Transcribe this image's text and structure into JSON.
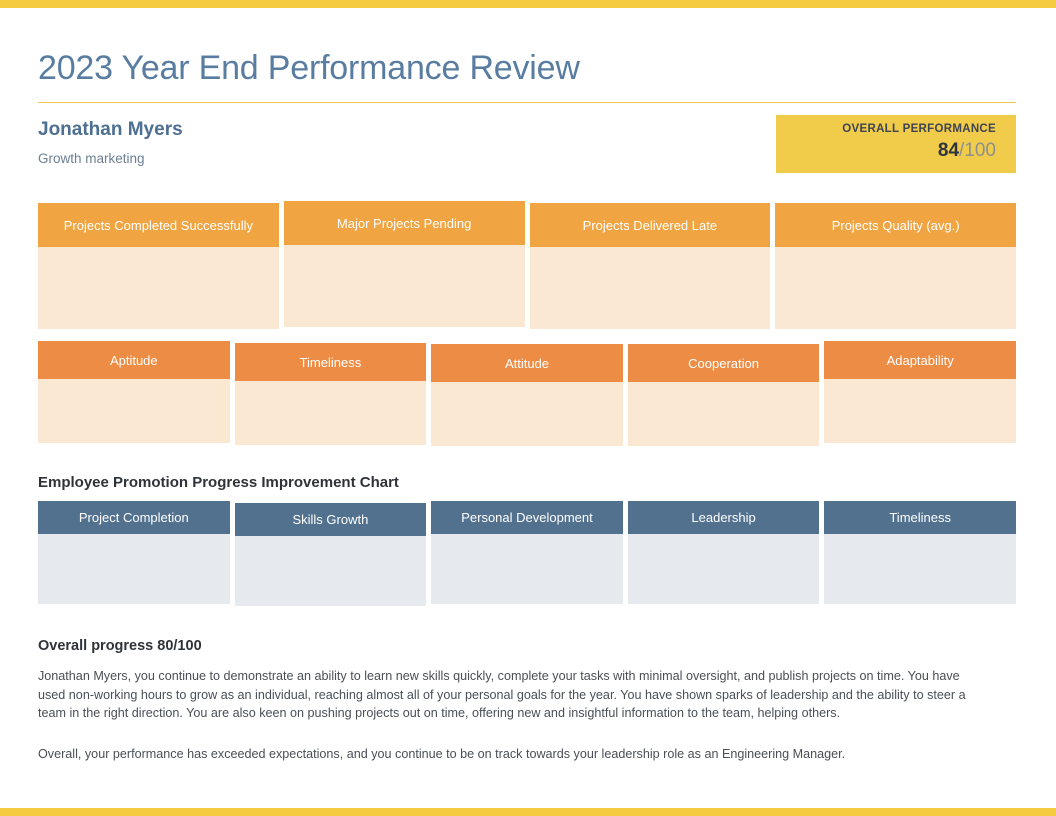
{
  "theme": {
    "accent_yellow": "#f5cb42",
    "title_blue": "#597da0",
    "card_orange_light": "#f0a442",
    "card_orange_deep": "#ed8c44",
    "card_peach_body": "#fbe8d2",
    "card_slate_header": "#52718f",
    "card_slate_body": "#e6e9ee"
  },
  "header": {
    "title": "2023 Year End Performance Review"
  },
  "employee": {
    "name": "Jonathan Myers",
    "role": "Growth marketing"
  },
  "overall_badge": {
    "label": "OVERALL PERFORMANCE",
    "score": "84",
    "max": "/100"
  },
  "projects_row": {
    "cards": [
      {
        "label": "Projects Completed Successfully"
      },
      {
        "label": "Major Projects Pending"
      },
      {
        "label": "Projects Delivered Late"
      },
      {
        "label": "Projects Quality (avg.)"
      }
    ]
  },
  "traits_row": {
    "cards": [
      {
        "label": "Aptitude"
      },
      {
        "label": "Timeliness"
      },
      {
        "label": "Attitude"
      },
      {
        "label": "Cooperation"
      },
      {
        "label": "Adaptability"
      }
    ]
  },
  "chart_section": {
    "title": "Employee Promotion Progress Improvement Chart",
    "cards": [
      {
        "label": "Project Completion"
      },
      {
        "label": "Skills Growth"
      },
      {
        "label": "Personal Development"
      },
      {
        "label": "Leadership"
      },
      {
        "label": "Timeliness"
      }
    ]
  },
  "summary": {
    "title": "Overall progress 80/100",
    "paragraph_1": "Jonathan Myers, you continue to demonstrate an ability to learn new skills quickly, complete your tasks with minimal oversight, and publish projects on time. You have used non-working hours to grow as an individual, reaching almost all of your personal goals for the year. You have shown sparks of leadership and the ability to steer a team in the right direction. You are also keen on pushing projects out on time, offering new and insightful information to the team, helping others.",
    "paragraph_2": "Overall, your performance has exceeded expectations, and you continue to be on track towards your leadership role as an Engineering Manager."
  }
}
